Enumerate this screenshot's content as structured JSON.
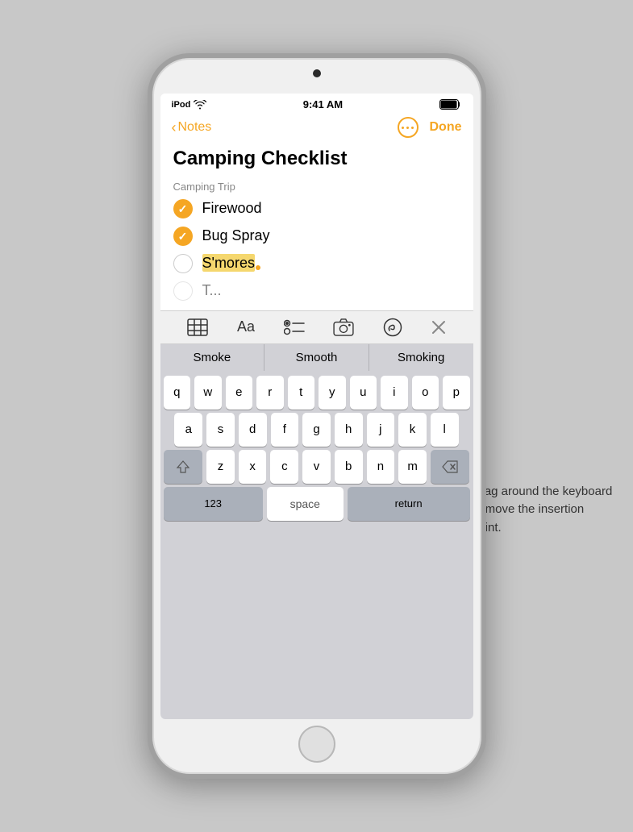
{
  "device": {
    "status_bar": {
      "carrier": "iPod",
      "time": "9:41 AM"
    },
    "nav": {
      "back_label": "Notes",
      "more_label": "•••",
      "done_label": "Done"
    },
    "note": {
      "title": "Camping Checklist",
      "section": "Camping Trip",
      "items": [
        {
          "id": 1,
          "checked": true,
          "text": "Firewood"
        },
        {
          "id": 2,
          "checked": true,
          "text": "Bug Spray"
        },
        {
          "id": 3,
          "checked": false,
          "text": "S'mores",
          "selected": true
        },
        {
          "id": 4,
          "checked": false,
          "text": "T...",
          "partial": true
        }
      ]
    },
    "toolbar": {
      "table_icon": "⊞",
      "format_icon": "Aa",
      "list_icon": "list",
      "camera_icon": "camera",
      "markup_icon": "markup",
      "close_icon": "✕"
    },
    "autocorrect": {
      "suggestions": [
        "Smoke",
        "Smooth",
        "Smoking"
      ]
    },
    "keyboard": {
      "rows": [
        [
          "q",
          "w",
          "e",
          "r",
          "t",
          "y",
          "u",
          "i",
          "o",
          "p"
        ],
        [
          "a",
          "s",
          "d",
          "f",
          "g",
          "h",
          "j",
          "k",
          "l"
        ],
        [
          "⇧",
          "z",
          "x",
          "c",
          "v",
          "b",
          "n",
          "m",
          "⌫"
        ],
        [
          "123",
          "space",
          "return"
        ]
      ]
    }
  },
  "annotation": {
    "text": "Drag around the keyboard to move the insertion point."
  }
}
